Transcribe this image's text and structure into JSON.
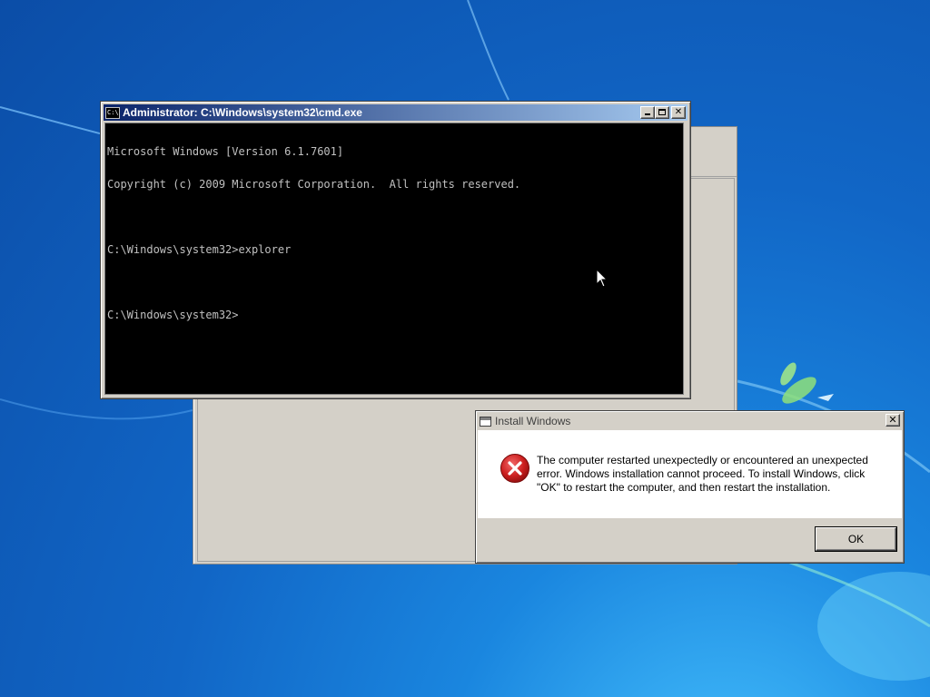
{
  "cmd_window": {
    "title": "Administrator: C:\\Windows\\system32\\cmd.exe",
    "icon_text": "C:\\",
    "buttons": {
      "close": "✕"
    },
    "lines": [
      "Microsoft Windows [Version 6.1.7601]",
      "Copyright (c) 2009 Microsoft Corporation.  All rights reserved.",
      "",
      "C:\\Windows\\system32>explorer",
      "",
      "C:\\Windows\\system32>"
    ]
  },
  "dialog": {
    "title": "Install Windows",
    "close_glyph": "✕",
    "message": "The computer restarted unexpectedly or encountered an unexpected error. Windows installation cannot proceed. To install Windows, click \"OK\" to restart the computer, and then restart the installation.",
    "ok_label": "OK",
    "icon": "error-icon"
  },
  "colors": {
    "desktop_blue": "#1166c6",
    "titlebar_active": "#0a246a",
    "console_bg": "#000000",
    "console_text": "#c0c0c0",
    "error_red": "#cc1f1f"
  }
}
